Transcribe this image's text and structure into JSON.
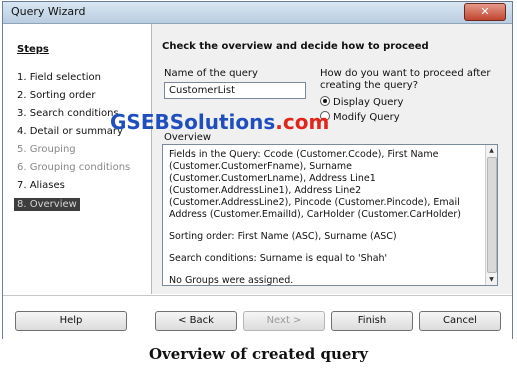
{
  "window": {
    "title": "Query Wizard"
  },
  "steps": {
    "heading": "Steps",
    "items": [
      {
        "label": "1. Field selection"
      },
      {
        "label": "2. Sorting order"
      },
      {
        "label": "3. Search conditions"
      },
      {
        "label": "4. Detail or summary"
      },
      {
        "label": "5. Grouping"
      },
      {
        "label": "6. Grouping conditions"
      },
      {
        "label": "7. Aliases"
      },
      {
        "label": "8. Overview"
      }
    ]
  },
  "main": {
    "heading": "Check the overview and decide how to proceed",
    "name_label": "Name of the query",
    "name_value": "CustomerList",
    "proceed_label_1": "How do you want to proceed after",
    "proceed_label_2": "creating the query?",
    "radio_display": "Display Query",
    "radio_modify": "Modify Query",
    "overview_label": "Overview",
    "overview_fields": "Fields in the Query: Ccode (Customer.Ccode), First Name (Customer.CustomerFname), Surname (Customer.CustomerLname), Address Line1 (Customer.AddressLine1), Address Line2 (Customer.AddressLine2), Pincode (Customer.Pincode), Email Address (Customer.EmailId), CarHolder (Customer.CarHolder)",
    "overview_sorting": "Sorting order: First Name (ASC), Surname (ASC)",
    "overview_search": "Search conditions: Surname is equal to 'Shah'",
    "overview_groups": "No Groups were assigned."
  },
  "buttons": {
    "help": "Help",
    "back": "< Back",
    "next": "Next >",
    "finish": "Finish",
    "cancel": "Cancel"
  },
  "watermark": {
    "part1": "GSEB",
    "part2": "Solutions",
    "part3": ".com"
  },
  "caption": "Overview of created query"
}
